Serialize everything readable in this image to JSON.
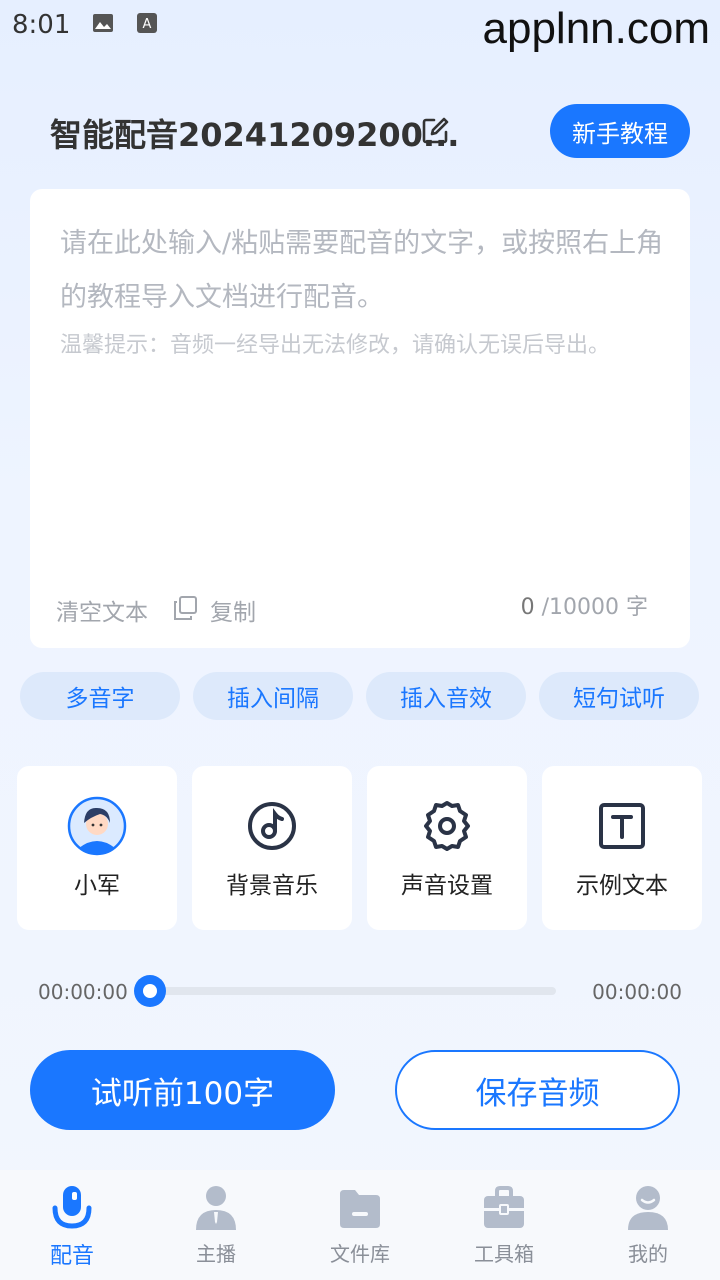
{
  "status_bar": {
    "time": "8:01"
  },
  "watermark": "applnn.com",
  "header": {
    "title": "智能配音20241209200...",
    "tutorial_button": "新手教程"
  },
  "editor": {
    "placeholder": "请在此处输入/粘贴需要配音的文字，或按照右上角的教程导入文档进行配音。",
    "tip": "温馨提示：音频一经导出无法修改，请确认无误后导出。",
    "clear_label": "清空文本",
    "copy_label": "复制",
    "count": "0",
    "limit": " /10000 字"
  },
  "chips": [
    "多音字",
    "插入间隔",
    "插入音效",
    "短句试听"
  ],
  "tools": [
    {
      "label": "小军",
      "icon": "avatar-icon"
    },
    {
      "label": "背景音乐",
      "icon": "music-note-icon"
    },
    {
      "label": "声音设置",
      "icon": "gear-icon"
    },
    {
      "label": "示例文本",
      "icon": "text-box-icon"
    }
  ],
  "player": {
    "current": "00:00:00",
    "total": "00:00:00",
    "progress": 0
  },
  "actions": {
    "preview": "试听前100字",
    "save": "保存音频"
  },
  "nav": [
    {
      "label": "配音",
      "icon": "microphone-icon",
      "active": true
    },
    {
      "label": "主播",
      "icon": "person-icon",
      "active": false
    },
    {
      "label": "文件库",
      "icon": "folder-icon",
      "active": false
    },
    {
      "label": "工具箱",
      "icon": "toolbox-icon",
      "active": false
    },
    {
      "label": "我的",
      "icon": "profile-icon",
      "active": false
    }
  ],
  "colors": {
    "accent": "#1a77ff",
    "chip_bg": "#dde9fb",
    "nav_inactive": "#8a8f98"
  }
}
